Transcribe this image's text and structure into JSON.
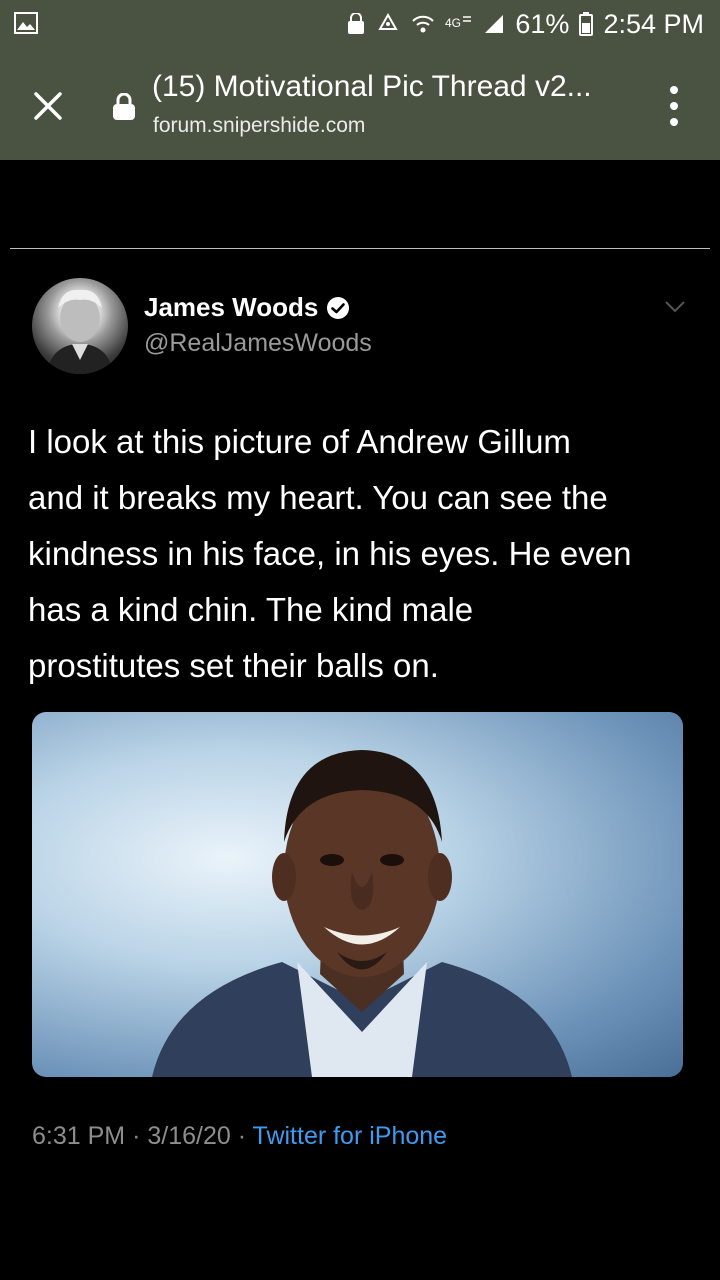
{
  "status_bar": {
    "battery": "61%",
    "time": "2:54 PM",
    "icons": [
      "gallery-icon",
      "lock-icon",
      "recycle-icon",
      "wifi-icon",
      "4g-icon",
      "signal-icon",
      "battery-icon"
    ]
  },
  "browser": {
    "title": "(15) Motivational Pic Thread v2...",
    "url": "forum.snipershide.com",
    "icons": [
      "close-icon",
      "lock-icon",
      "more-vert-icon"
    ],
    "background_color": "#4a5341"
  },
  "tweet": {
    "author_name": "James Woods",
    "handle": "@RealJamesWoods",
    "text": "I look at this picture of Andrew Gillum\nand it breaks my heart. You can see the\nkindness in his face, in his eyes. He even\nhas a kind chin. The kind male\nprostitutes set their balls on.",
    "time": "6:31 PM",
    "sep1": "·",
    "date": "3/16/20",
    "sep2": "·",
    "source": "Twitter for iPhone",
    "source_color": "#3e9bf0"
  }
}
